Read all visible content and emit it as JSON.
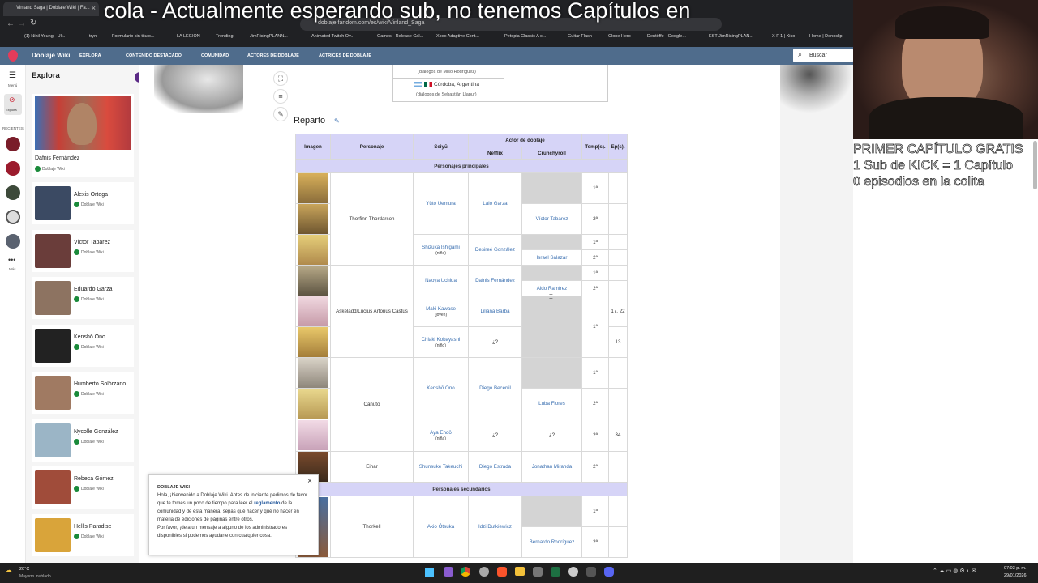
{
  "browser": {
    "tab_title": "Vinland Saga | Doblaje Wiki | Fa...",
    "url": "doblaje.fandom.com/es/wiki/Vinland_Saga",
    "bookmarks": [
      "(1) Nihil Young - Ult...",
      "tryn",
      "Formulario sin titulo...",
      "LA LEGION",
      "Trending",
      "JimRisingPLANN...",
      "Animated Twitch Ov...",
      "Games - Release Cal...",
      "Xbox Adaptive Cont...",
      "Petopia Classic A c...",
      "Guitar Flash",
      "Clone Hero",
      "Dentöffe - Google...",
      "EST JimRisingPLAN...",
      "X F 1 | Xico",
      "Home | Denoclip"
    ]
  },
  "overlay": {
    "title": "cola - Actualmente esperando sub, no tenemos Capítulos en",
    "side_lines": [
      "PRIMER CAPÍTULO GRATIS",
      "1 Sub de KICK = 1 Capítulo",
      "0 episodios en la colita"
    ]
  },
  "wiki": {
    "logo": "Doblaje Wiki",
    "menu": [
      "EXPLORA",
      "CONTENIDO DESTACADO",
      "COMUNIDAD",
      "ACTORES DE DOBLAJE",
      "ACTRICES DE DOBLAJE"
    ],
    "search_placeholder": "Buscar"
  },
  "rail": {
    "menu_label": "Menú",
    "explore_label": "Explora",
    "recent_label": "RECIENTES",
    "more_label": "Más"
  },
  "sidebar": {
    "title": "Explora",
    "featured": {
      "name": "Dafnis Fernández",
      "source": "Doblaje Wiki"
    },
    "items": [
      {
        "name": "Alexis Ortega",
        "source": "Doblaje Wiki",
        "color": "#3b4a63"
      },
      {
        "name": "Víctor Tabarez",
        "source": "Doblaje Wiki",
        "color": "#6a3d3a"
      },
      {
        "name": "Eduardo Garza",
        "source": "Doblaje Wiki",
        "color": "#8d7361"
      },
      {
        "name": "Kenshō Ono",
        "source": "Doblaje Wiki",
        "color": "#222222"
      },
      {
        "name": "Humberto Solórzano",
        "source": "Doblaje Wiki",
        "color": "#a07a62"
      },
      {
        "name": "Nycolle González",
        "source": "Doblaje Wiki",
        "color": "#9bb5c6"
      },
      {
        "name": "Rebeca Gómez",
        "source": "Doblaje Wiki",
        "color": "#a04c3a"
      },
      {
        "name": "Hell's Paradise",
        "source": "Doblaje Wiki",
        "color": "#d9a43a"
      }
    ]
  },
  "top_fragment": {
    "line1": "(diálogos de Miso Rodríguez)",
    "city": "Córdoba, Argentina",
    "line2": "(diálogos de Sebastián Llapur)"
  },
  "section_title": "Reparto",
  "table": {
    "headers": {
      "imagen": "Imagen",
      "personaje": "Personaje",
      "seiyu": "Seiyū",
      "actor": "Actor de doblaje",
      "netflix": "Netflix",
      "crunchyroll": "Crunchyroll",
      "temp": "Temp(s).",
      "ep": "Ep(s)."
    },
    "principales": "Personajes principales",
    "secundarios": "Personajes secundarios",
    "unknown": "¿?",
    "rows": {
      "thorfinn": "Thorfinn Thordarson",
      "yuto": "Yūto Uemura",
      "lalo": "Lalo Garza",
      "victor": "Víctor Tabarez",
      "shizuka": "Shizuka Ishigami",
      "nino": "(niño)",
      "desiree": "Desireé González",
      "israel": "Israel Salazar",
      "askeladd": "Askeladd/Lucius Artorius Castus",
      "naoya": "Naoya Uchida",
      "dafnis": "Dafnis Fernández",
      "aldo": "Aldo Ramírez",
      "maki": "Maki Kawase",
      "joven": "(joven)",
      "liliana": "Liliana Barba",
      "ep1722": "17, 22",
      "chiaki": "Chiaki Kobayashi",
      "ep13": "13",
      "canuto": "Canuto",
      "kensho": "Kenshō Ono",
      "diego": "Diego Becerril",
      "luba": "Luba Flores",
      "aya": "Aya Endō",
      "nina": "(niña)",
      "ep34": "34",
      "einar": "Einar",
      "shunsuke": "Shunsuke Takeuchi",
      "diegoe": "Diego Estrada",
      "jonathan": "Jonathan Miranda",
      "thorkell": "Thorkell",
      "akio": "Akio Ōtsuka",
      "idzi": "Idzi Dutkiewicz",
      "bernardo": "Bernardo Rodríguez",
      "t1": "1ª",
      "t2": "2ª"
    }
  },
  "notice": {
    "title": "DOBLAJE WIKI",
    "text1": "Hola, ¡bienvenido a Doblaje Wiki. Antes de iniciar te pedimos de favor que te tomes un poco de tiempo para leer el",
    "link": "reglamento",
    "text2": "de la comunidad y de esta manera, sepas qué hacer y qué no hacer en materia de ediciones de páginas entre otros.",
    "text3": "Por favor, ¡deja un mensaje a alguno de los administradores disponibles si podemos ayudarte con cualquier cosa."
  },
  "taskbar": {
    "weather_temp": "20°C",
    "weather_desc": "Mayorm. nublado",
    "time": "07:03 p. m.",
    "date": "29/01/2026"
  }
}
